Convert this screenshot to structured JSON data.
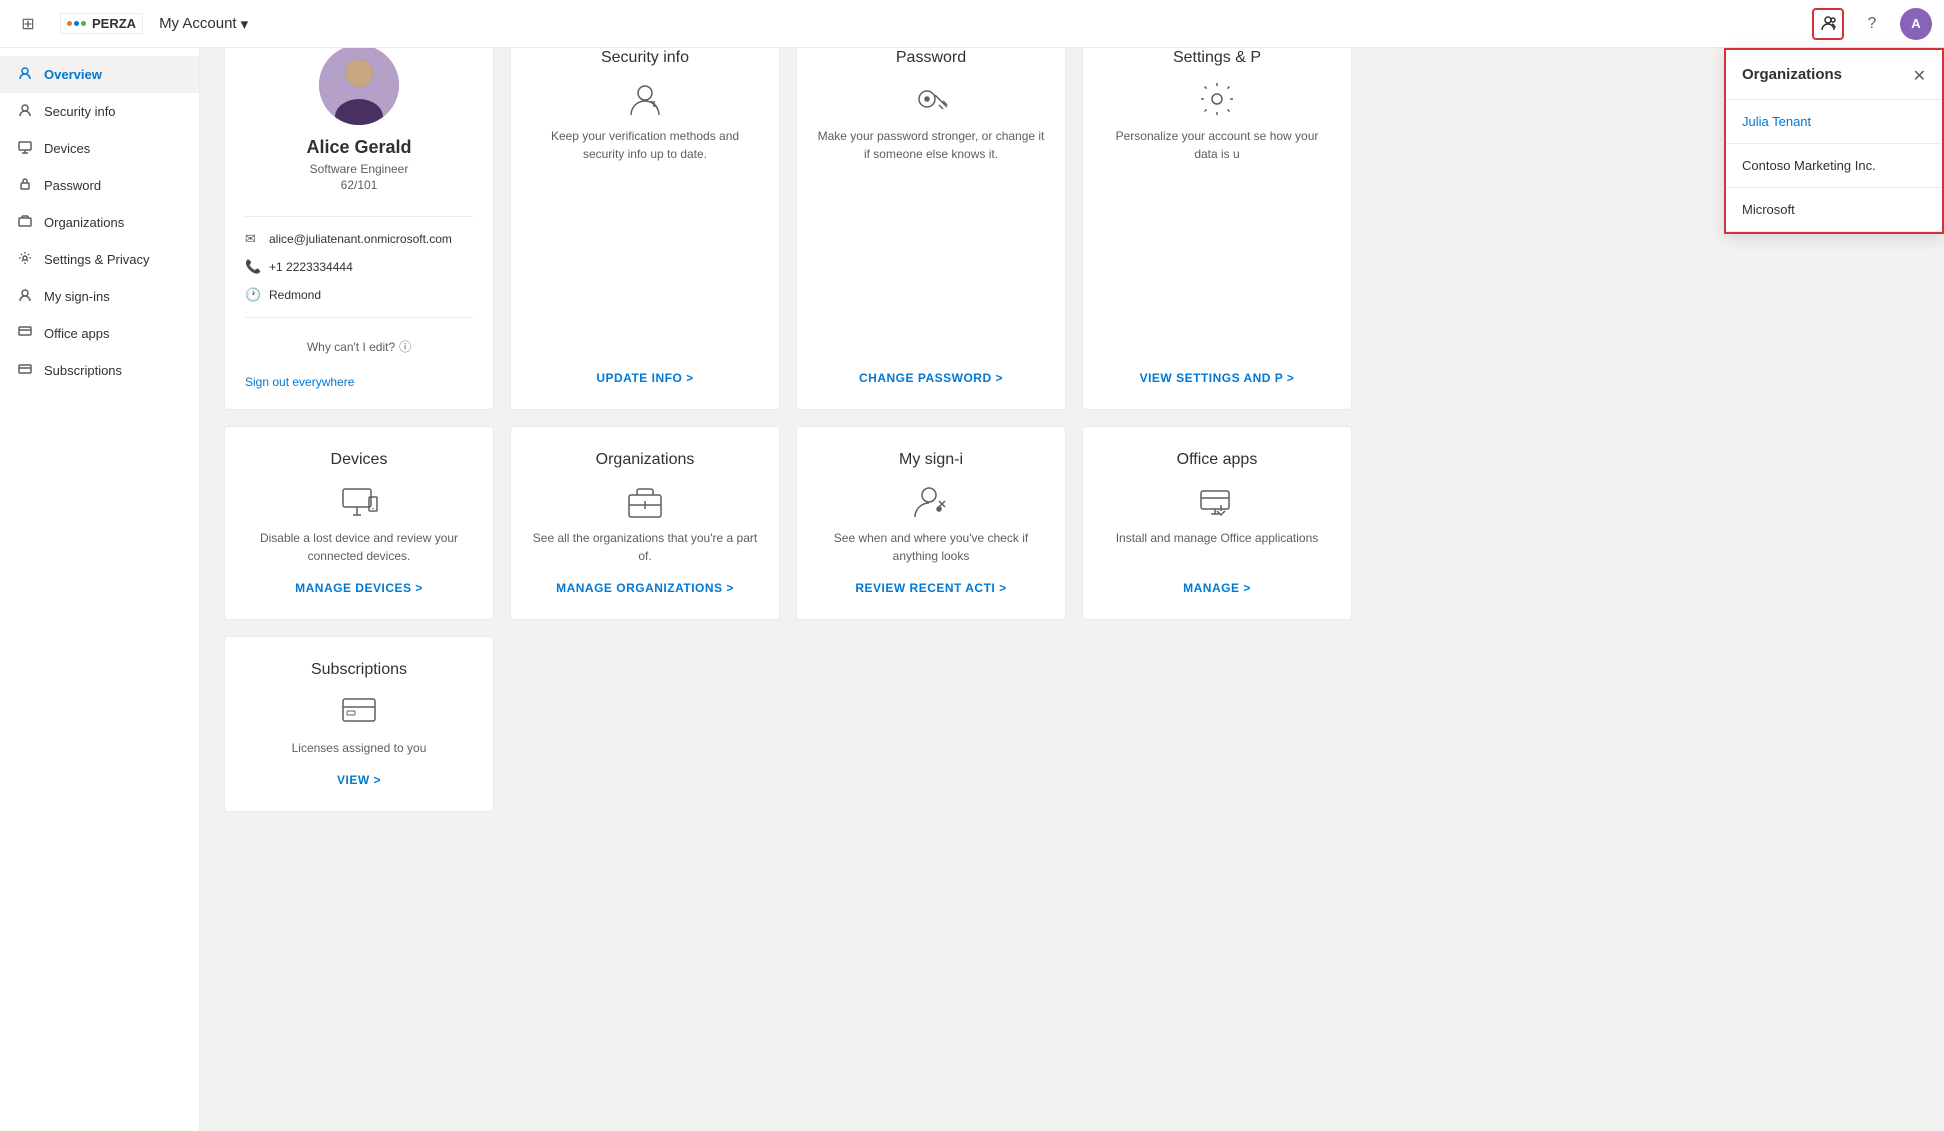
{
  "topnav": {
    "logo_text": "PERZA",
    "app_title": "My Account",
    "help_icon": "?",
    "chevron_icon": "▾"
  },
  "sidebar": {
    "items": [
      {
        "id": "overview",
        "label": "Overview",
        "icon": "👤",
        "active": true
      },
      {
        "id": "security-info",
        "label": "Security info",
        "icon": "👤"
      },
      {
        "id": "devices",
        "label": "Devices",
        "icon": "🖥"
      },
      {
        "id": "password",
        "label": "Password",
        "icon": "🔑"
      },
      {
        "id": "organizations",
        "label": "Organizations",
        "icon": "🏢"
      },
      {
        "id": "settings-privacy",
        "label": "Settings & Privacy",
        "icon": "⚙"
      },
      {
        "id": "my-signins",
        "label": "My sign-ins",
        "icon": "👤"
      },
      {
        "id": "office-apps",
        "label": "Office apps",
        "icon": "🖥"
      },
      {
        "id": "subscriptions",
        "label": "Subscriptions",
        "icon": "🖥"
      }
    ]
  },
  "profile": {
    "name": "Alice Gerald",
    "title": "Software Engineer",
    "id": "62/101",
    "email": "alice@juliatenant.onmicrosoft.com",
    "phone": "+1 2223334444",
    "location": "Redmond",
    "edit_label": "Why can't I edit?",
    "sign_out_label": "Sign out everywhere"
  },
  "cards": [
    {
      "id": "security-info",
      "title": "Security info",
      "description": "Keep your verification methods and security info up to date.",
      "link_label": "UPDATE INFO"
    },
    {
      "id": "password",
      "title": "Password",
      "description": "Make your password stronger, or change it if someone else knows it.",
      "link_label": "CHANGE PASSWORD"
    },
    {
      "id": "settings-privacy",
      "title": "Settings & P",
      "description": "Personalize your account se how your data is u",
      "link_label": "VIEW SETTINGS AND P"
    },
    {
      "id": "devices",
      "title": "Devices",
      "description": "Disable a lost device and review your connected devices.",
      "link_label": "MANAGE DEVICES"
    },
    {
      "id": "organizations",
      "title": "Organizations",
      "description": "See all the organizations that you're a part of.",
      "link_label": "MANAGE ORGANIZATIONS"
    },
    {
      "id": "my-signins",
      "title": "My sign-i",
      "description": "See when and where you've check if anything looks",
      "link_label": "REVIEW RECENT ACTI"
    },
    {
      "id": "office-apps",
      "title": "Office apps",
      "description": "Install and manage Office applications",
      "link_label": "MANAGE"
    },
    {
      "id": "subscriptions",
      "title": "Subscriptions",
      "description": "Licenses assigned to you",
      "link_label": "VIEW"
    }
  ],
  "org_panel": {
    "title": "Organizations",
    "items": [
      {
        "name": "Julia Tenant",
        "active": true
      },
      {
        "name": "Contoso Marketing Inc.",
        "active": false
      },
      {
        "name": "Microsoft",
        "active": false
      }
    ]
  }
}
